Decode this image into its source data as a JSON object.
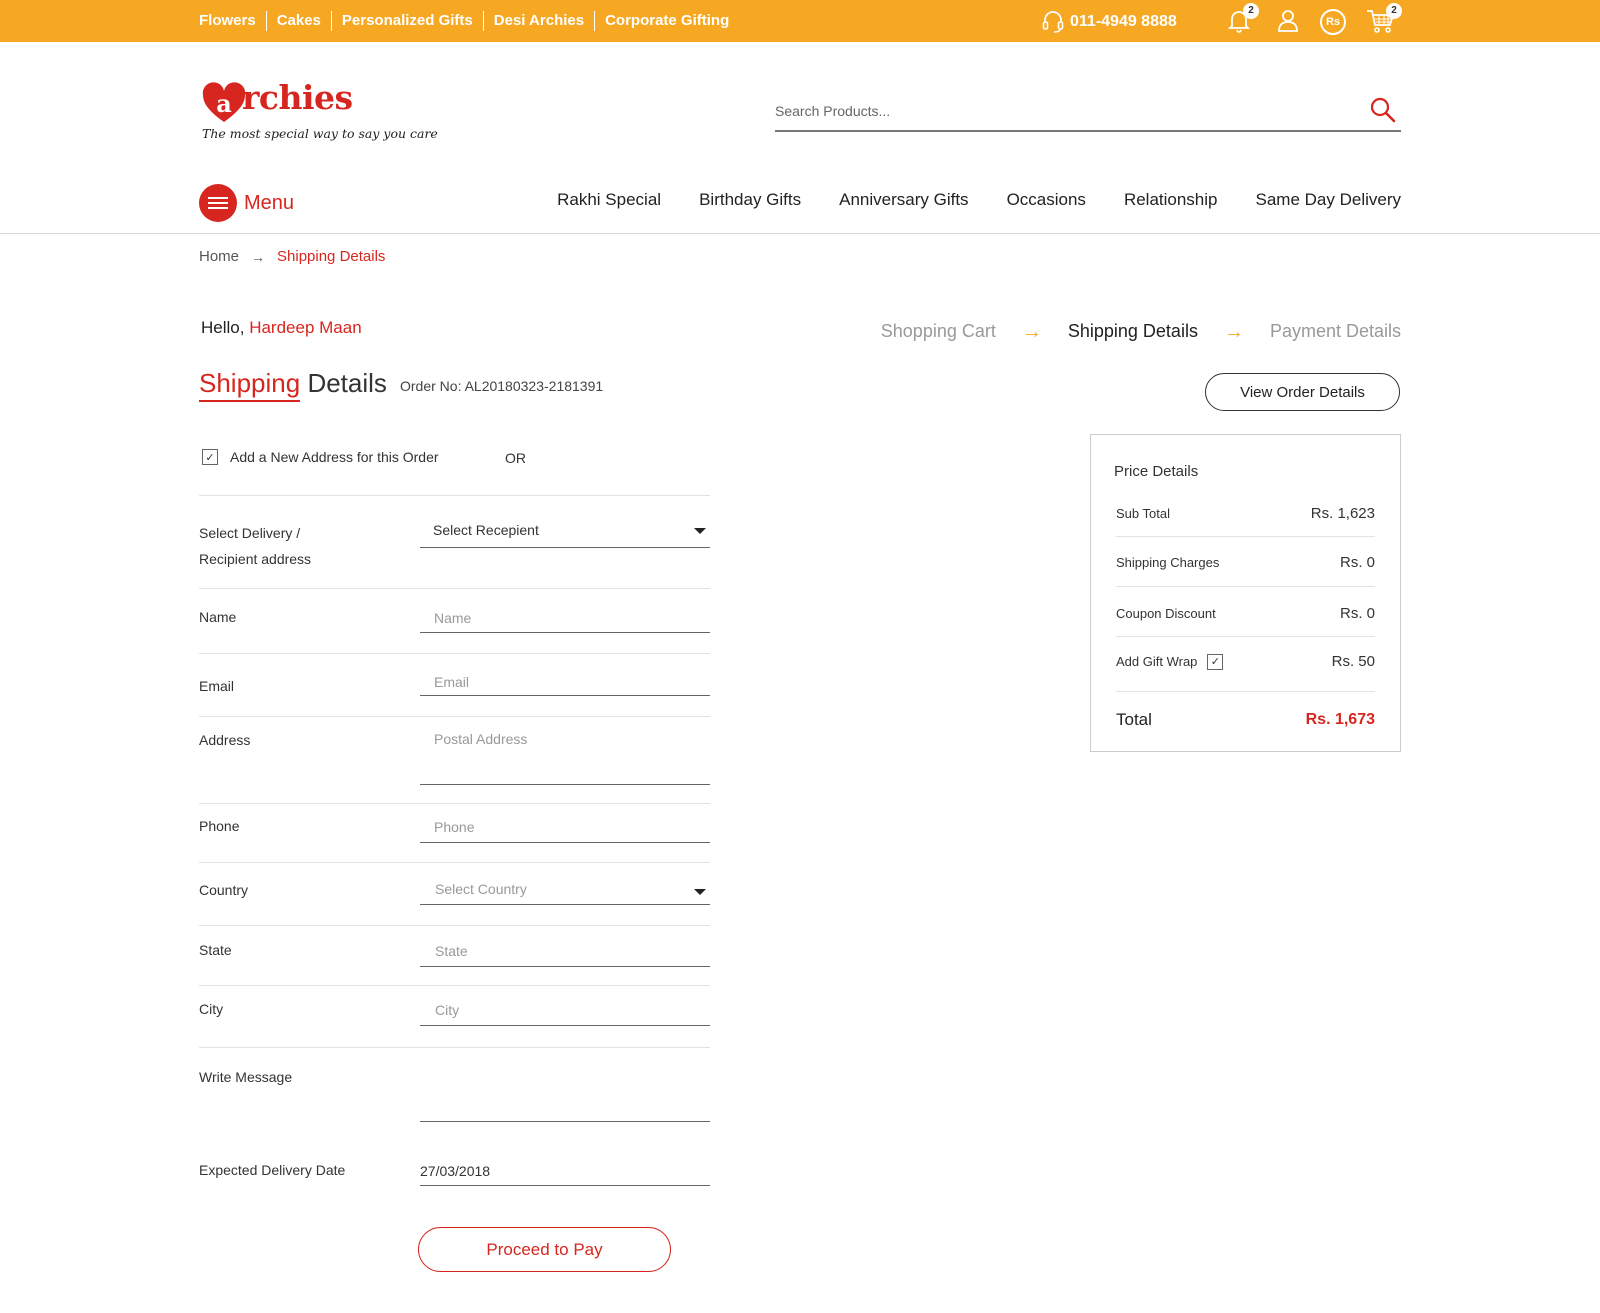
{
  "topbar": {
    "links": [
      "Flowers",
      "Cakes",
      "Personalized Gifts",
      "Desi Archies",
      "Corporate Gifting"
    ],
    "phone": "011-4949 8888",
    "notification_count": "2",
    "currency_symbol": "Rs",
    "cart_count": "2",
    "colors": {
      "bar": "#f7a823",
      "brand_red": "#d7261f"
    }
  },
  "header": {
    "logo_text": "archies",
    "logo_tagline": "The most special way to say you care",
    "search_placeholder": "Search Products..."
  },
  "nav": {
    "menu_label": "Menu",
    "items": [
      "Rakhi Special",
      "Birthday Gifts",
      "Anniversary Gifts",
      "Occasions",
      "Relationship",
      "Same Day Delivery"
    ]
  },
  "breadcrumb": {
    "home": "Home",
    "current": "Shipping Details"
  },
  "greeting": {
    "hello": "Hello,",
    "user_name": "Hardeep Maan"
  },
  "steps": [
    "Shopping Cart",
    "Shipping Details",
    "Payment Details"
  ],
  "page": {
    "title_red": "Shipping",
    "title_rest": "Details",
    "order_no": "Order No: AL20180323-2181391",
    "view_order_label": "View Order Details"
  },
  "form": {
    "new_address_label": "Add a New Address for this Order",
    "or_label": "OR",
    "recipient_label_line1": "Select Delivery /",
    "recipient_label_line2": "Recipient address",
    "recipient_value": "Select Recepient",
    "name_label": "Name",
    "name_placeholder": "Name",
    "email_label": "Email",
    "email_placeholder": "Email",
    "address_label": "Address",
    "address_placeholder": "Postal Address",
    "phone_label": "Phone",
    "phone_placeholder": "Phone",
    "country_label": "Country",
    "country_value": "Select Country",
    "state_label": "State",
    "state_placeholder": "State",
    "city_label": "City",
    "city_placeholder": "City",
    "message_label": "Write Message",
    "message_value": "",
    "delivery_date_label": "Expected Delivery Date",
    "delivery_date_value": "27/03/2018",
    "proceed_label": "Proceed to Pay"
  },
  "price_details": {
    "title": "Price Details",
    "rows": [
      {
        "label": "Sub Total",
        "value": "Rs. 1,623"
      },
      {
        "label": "Shipping Charges",
        "value": "Rs. 0"
      },
      {
        "label": "Coupon Discount",
        "value": "Rs. 0"
      },
      {
        "label": "Add Gift Wrap",
        "value": "Rs. 50"
      }
    ],
    "total_label": "Total",
    "total_value": "Rs. 1,673"
  }
}
